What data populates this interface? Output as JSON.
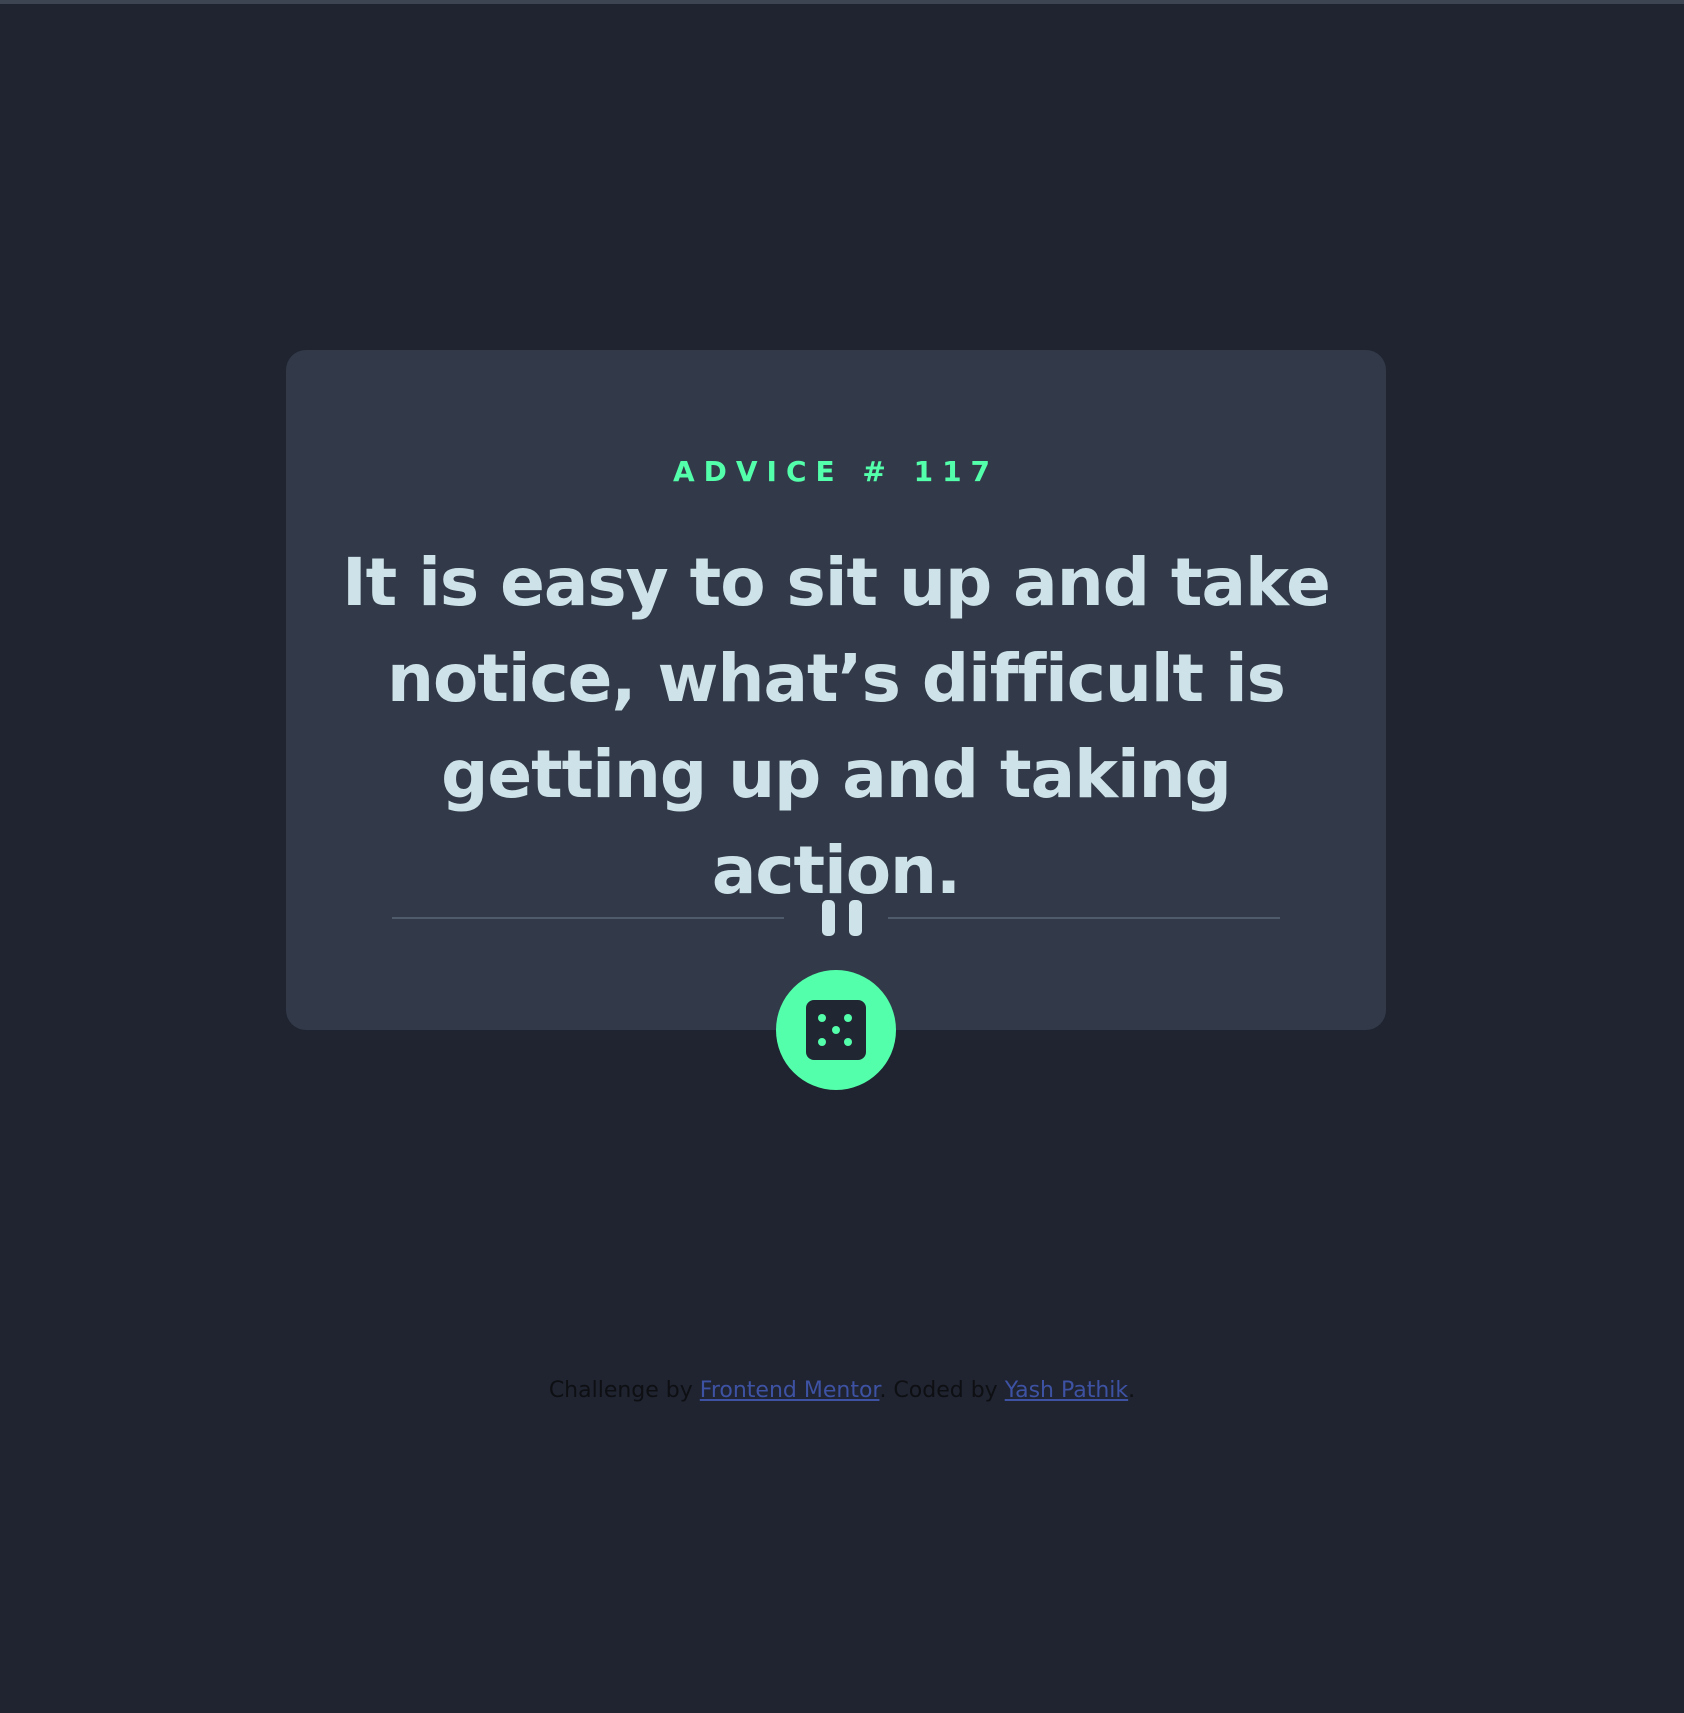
{
  "card": {
    "advice_label": "ADVICE # 117",
    "quote": "It is easy to sit up and take notice, what’s difficult is getting up and taking action."
  },
  "divider": {
    "icon": "pause-icon"
  },
  "dice_button": {
    "icon": "dice-icon"
  },
  "footer": {
    "challenge_prefix": "Challenge by ",
    "challenge_link": "Frontend Mentor",
    "coded_prefix": ". Coded by ",
    "coded_link": "Yash Pathik",
    "suffix": "."
  },
  "colors": {
    "background": "#1f2430",
    "card": "#323a49",
    "accent": "#53ffaa",
    "quote_text": "#cee3e9",
    "link": "#3e52a3"
  }
}
